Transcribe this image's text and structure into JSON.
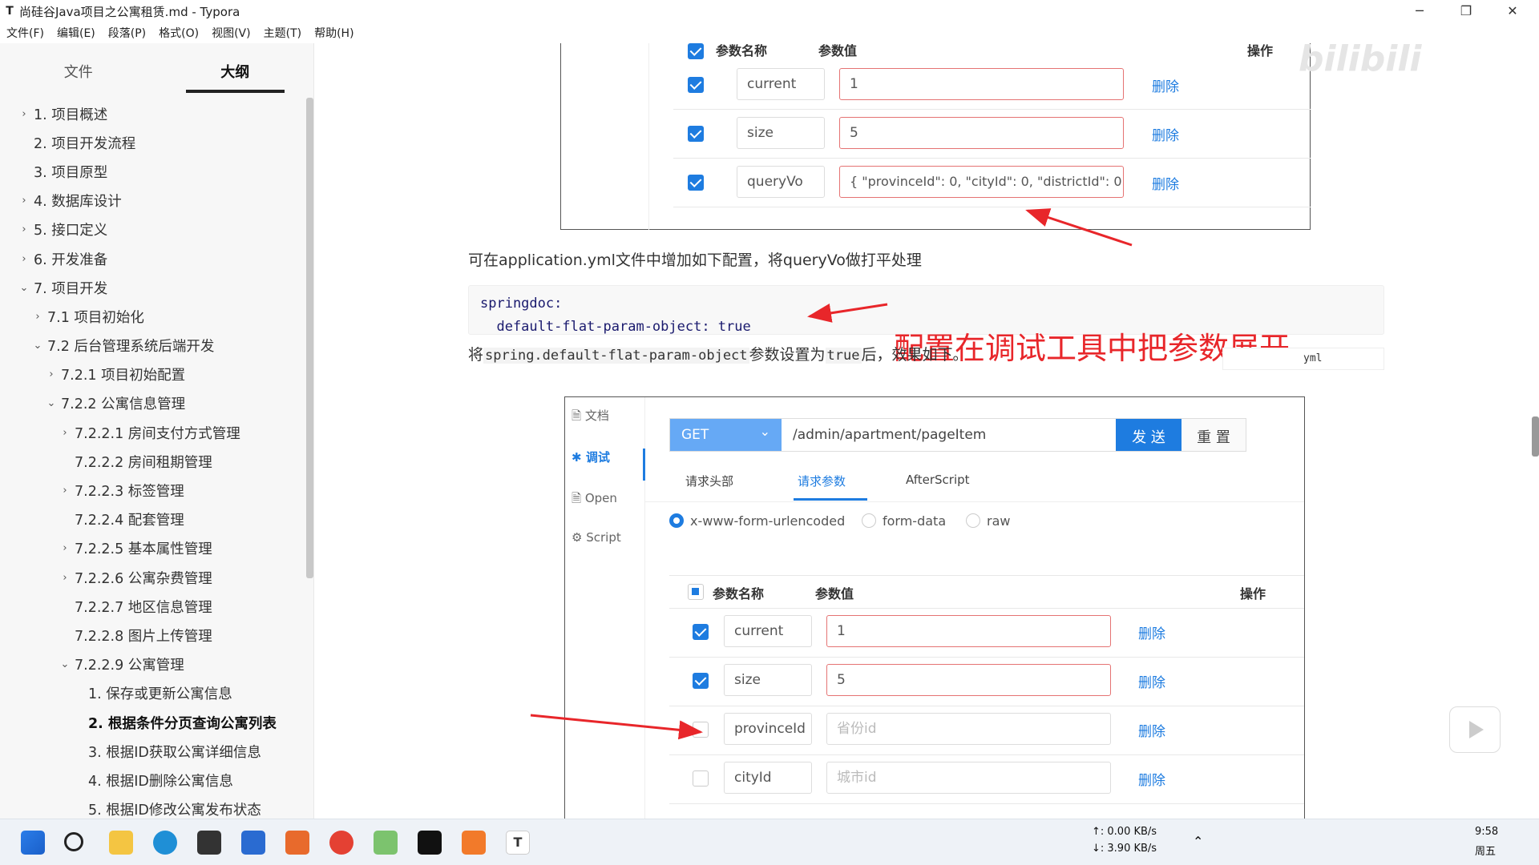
{
  "window": {
    "title": "尚硅谷Java项目之公寓租赁.md - Typora",
    "logo": "T",
    "controls": [
      "─",
      "❐",
      "✕"
    ]
  },
  "menu": [
    "文件(F)",
    "编辑(E)",
    "段落(P)",
    "格式(O)",
    "视图(V)",
    "主题(T)",
    "帮助(H)"
  ],
  "sidebar": {
    "tabs": [
      "文件",
      "大纲"
    ],
    "active_tab": "大纲",
    "outline": [
      {
        "label": "1. 项目概述",
        "indent": 0,
        "caret": "›"
      },
      {
        "label": "2. 项目开发流程",
        "indent": 0,
        "caret": ""
      },
      {
        "label": "3. 项目原型",
        "indent": 0,
        "caret": ""
      },
      {
        "label": "4. 数据库设计",
        "indent": 0,
        "caret": "›"
      },
      {
        "label": "5. 接口定义",
        "indent": 0,
        "caret": "›"
      },
      {
        "label": "6. 开发准备",
        "indent": 0,
        "caret": "›"
      },
      {
        "label": "7. 项目开发",
        "indent": 0,
        "caret": "⌄"
      },
      {
        "label": "7.1 项目初始化",
        "indent": 1,
        "caret": "›"
      },
      {
        "label": "7.2 后台管理系统后端开发",
        "indent": 1,
        "caret": "⌄"
      },
      {
        "label": "7.2.1 项目初始配置",
        "indent": 2,
        "caret": "›"
      },
      {
        "label": "7.2.2 公寓信息管理",
        "indent": 2,
        "caret": "⌄"
      },
      {
        "label": "7.2.2.1 房间支付方式管理",
        "indent": 3,
        "caret": "›"
      },
      {
        "label": "7.2.2.2 房间租期管理",
        "indent": 3,
        "caret": ""
      },
      {
        "label": "7.2.2.3 标签管理",
        "indent": 3,
        "caret": "›"
      },
      {
        "label": "7.2.2.4 配套管理",
        "indent": 3,
        "caret": ""
      },
      {
        "label": "7.2.2.5 基本属性管理",
        "indent": 3,
        "caret": "›"
      },
      {
        "label": "7.2.2.6 公寓杂费管理",
        "indent": 3,
        "caret": "›"
      },
      {
        "label": "7.2.2.7 地区信息管理",
        "indent": 3,
        "caret": ""
      },
      {
        "label": "7.2.2.8 图片上传管理",
        "indent": 3,
        "caret": ""
      },
      {
        "label": "7.2.2.9 公寓管理",
        "indent": 3,
        "caret": "⌄"
      },
      {
        "label": "1. 保存或更新公寓信息",
        "indent": 4,
        "caret": ""
      },
      {
        "label": "2. 根据条件分页查询公寓列表",
        "indent": 4,
        "caret": "",
        "bold": true
      },
      {
        "label": "3. 根据ID获取公寓详细信息",
        "indent": 4,
        "caret": ""
      },
      {
        "label": "4. 根据ID删除公寓信息",
        "indent": 4,
        "caret": ""
      },
      {
        "label": "5. 根据ID修改公寓发布状态",
        "indent": 4,
        "caret": ""
      }
    ]
  },
  "img1": {
    "headers": {
      "name": "参数名称",
      "value": "参数值",
      "op": "操作"
    },
    "rows": [
      {
        "name": "current",
        "value": "1",
        "op": "删除"
      },
      {
        "name": "size",
        "value": "5",
        "op": "删除"
      },
      {
        "name": "queryVo",
        "value": "{ \"provinceId\": 0, \"cityId\": 0, \"districtId\": 0}",
        "op": "删除"
      }
    ]
  },
  "doc": {
    "para1": "可在application.yml文件中增加如下配置，将queryVo做打平处理",
    "code_line1": "springdoc:",
    "code_line2": "  default-flat-param-object: true",
    "code_lang": "yml",
    "annotation": "配置在调试工具中把参数展开",
    "para2_a": "将",
    "para2_code1": "spring.default-flat-param-object",
    "para2_b": "参数设置为",
    "para2_code2": "true",
    "para2_c": "后，效果如下。"
  },
  "img2": {
    "nav": [
      {
        "icon": "🗎",
        "label": "文档"
      },
      {
        "icon": "✱",
        "label": "调试"
      },
      {
        "icon": "🗎",
        "label": "Open"
      },
      {
        "icon": "⚙",
        "label": "Script"
      }
    ],
    "method": "GET",
    "url": "/admin/apartment/pageItem",
    "send": "发 送",
    "reset": "重 置",
    "tabs": [
      "请求头部",
      "请求参数",
      "AfterScript"
    ],
    "active_tab": "请求参数",
    "radios": [
      "x-www-form-urlencoded",
      "form-data",
      "raw"
    ],
    "selected_radio": "x-www-form-urlencoded",
    "headers": {
      "name": "参数名称",
      "value": "参数值",
      "op": "操作"
    },
    "rows": [
      {
        "name": "current",
        "value": "1",
        "placeholder": "",
        "checked": true,
        "op": "删除"
      },
      {
        "name": "size",
        "value": "5",
        "placeholder": "",
        "checked": true,
        "op": "删除"
      },
      {
        "name": "provinceId",
        "value": "",
        "placeholder": "省份id",
        "checked": false,
        "op": "删除"
      },
      {
        "name": "cityId",
        "value": "",
        "placeholder": "城市id",
        "checked": false,
        "op": "删除"
      }
    ]
  },
  "taskbar": {
    "net_up": "↑: 0.00 KB/s",
    "net_down": "↓: 3.90 KB/s",
    "time": "9:58",
    "day": "周五"
  },
  "colors": {
    "accent": "#1e7ce0",
    "annotation": "#e8262a",
    "arrow": "#e8262a"
  }
}
